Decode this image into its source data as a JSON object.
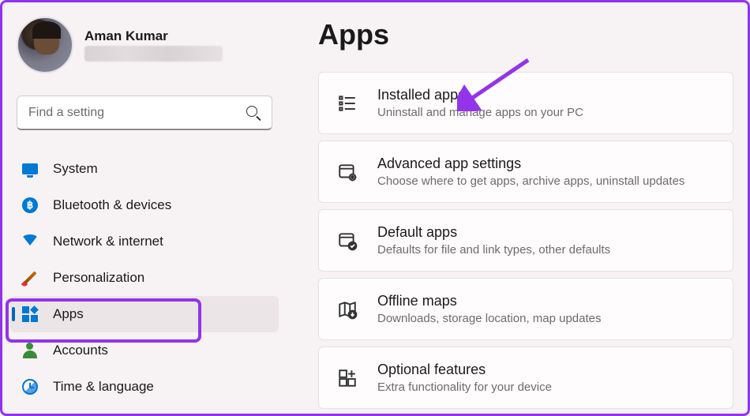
{
  "user": {
    "name": "Aman Kumar"
  },
  "search": {
    "placeholder": "Find a setting"
  },
  "nav": {
    "items": [
      {
        "label": "System"
      },
      {
        "label": "Bluetooth & devices"
      },
      {
        "label": "Network & internet"
      },
      {
        "label": "Personalization"
      },
      {
        "label": "Apps"
      },
      {
        "label": "Accounts"
      },
      {
        "label": "Time & language"
      }
    ]
  },
  "page": {
    "title": "Apps"
  },
  "cards": [
    {
      "title": "Installed apps",
      "desc": "Uninstall and manage apps on your PC"
    },
    {
      "title": "Advanced app settings",
      "desc": "Choose where to get apps, archive apps, uninstall updates"
    },
    {
      "title": "Default apps",
      "desc": "Defaults for file and link types, other defaults"
    },
    {
      "title": "Offline maps",
      "desc": "Downloads, storage location, map updates"
    },
    {
      "title": "Optional features",
      "desc": "Extra functionality for your device"
    }
  ]
}
